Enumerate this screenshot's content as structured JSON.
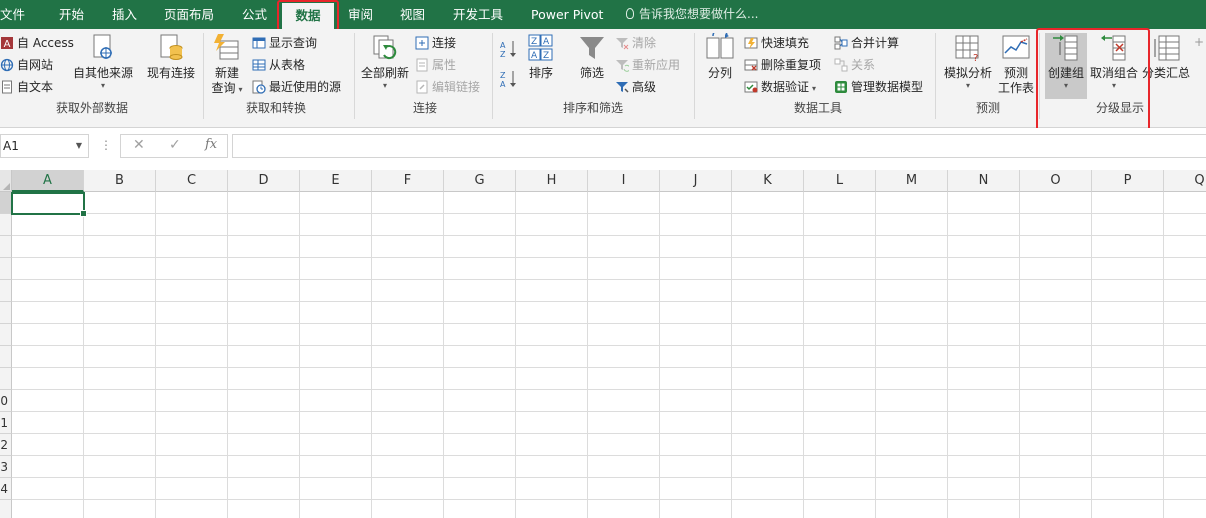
{
  "tabs": [
    "文件",
    "开始",
    "插入",
    "页面布局",
    "公式",
    "数据",
    "审阅",
    "视图",
    "开发工具",
    "Power Pivot"
  ],
  "active_tab": "数据",
  "tell_me": "告诉我您想要做什么...",
  "groups": {
    "external": {
      "label": "获取外部数据",
      "access": "自 Access",
      "web": "自网站",
      "text": "自文本",
      "other_sources": "自其他来源",
      "existing": "现有连接"
    },
    "transform": {
      "label": "获取和转换",
      "new_query": "新建",
      "new_query_2": "查询",
      "show_queries": "显示查询",
      "from_table": "从表格",
      "recent_sources": "最近使用的源"
    },
    "connections": {
      "label": "连接",
      "refresh_all": "全部刷新",
      "connections": "连接",
      "properties": "属性",
      "edit_links": "编辑链接"
    },
    "sort_filter": {
      "label": "排序和筛选",
      "sort": "排序",
      "filter": "筛选",
      "clear": "清除",
      "reapply": "重新应用",
      "advanced": "高级"
    },
    "data_tools": {
      "label": "数据工具",
      "text_to_columns": "分列",
      "flash_fill": "快速填充",
      "remove_duplicates": "删除重复项",
      "data_validation": "数据验证",
      "consolidate": "合并计算",
      "relationships": "关系",
      "data_model": "管理数据模型"
    },
    "forecast": {
      "label": "预测",
      "what_if": "模拟分析",
      "forecast_sheet": "预测",
      "forecast_sheet_2": "工作表"
    },
    "outline": {
      "label": "分级显示",
      "group": "创建组",
      "ungroup": "取消组合",
      "subtotal": "分类汇总"
    }
  },
  "name_box": "A1",
  "columns": [
    "A",
    "B",
    "C",
    "D",
    "E",
    "F",
    "G",
    "H",
    "I",
    "J",
    "K",
    "L",
    "M",
    "N",
    "O",
    "P",
    "Q"
  ],
  "rows": [
    "",
    "",
    "",
    "",
    "",
    "",
    "",
    "",
    "",
    "0",
    "1",
    "2",
    "3",
    "4",
    ""
  ],
  "colors": {
    "accent": "#217346",
    "highlight": "#e8262b"
  }
}
